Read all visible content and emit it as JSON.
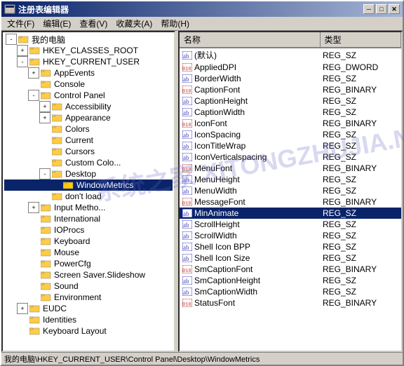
{
  "window": {
    "title": "注册表编辑器",
    "icon": "📋"
  },
  "titlebar_buttons": {
    "minimize": "─",
    "maximize": "□",
    "close": "✕"
  },
  "menu": {
    "items": [
      {
        "label": "文件(F)"
      },
      {
        "label": "编辑(E)"
      },
      {
        "label": "查看(V)"
      },
      {
        "label": "收藏夹(A)"
      },
      {
        "label": "帮助(H)"
      }
    ]
  },
  "tree": {
    "items": [
      {
        "id": "mypc",
        "label": "我的电脑",
        "level": 0,
        "expanded": true,
        "expander": "-",
        "has_expander": true
      },
      {
        "id": "hkcr",
        "label": "HKEY_CLASSES_ROOT",
        "level": 1,
        "expanded": false,
        "expander": "+",
        "has_expander": true
      },
      {
        "id": "hkcu",
        "label": "HKEY_CURRENT_USER",
        "level": 1,
        "expanded": true,
        "expander": "-",
        "has_expander": true
      },
      {
        "id": "appevents",
        "label": "AppEvents",
        "level": 2,
        "expanded": false,
        "expander": "+",
        "has_expander": true
      },
      {
        "id": "console",
        "label": "Console",
        "level": 2,
        "has_expander": false
      },
      {
        "id": "controlpanel",
        "label": "Control Panel",
        "level": 2,
        "expanded": true,
        "expander": "-",
        "has_expander": true
      },
      {
        "id": "accessibility",
        "label": "Accessibility",
        "level": 3,
        "expanded": false,
        "expander": "+",
        "has_expander": true
      },
      {
        "id": "appearance",
        "label": "Appearance",
        "level": 3,
        "expanded": false,
        "expander": "+",
        "has_expander": true
      },
      {
        "id": "colors",
        "label": "Colors",
        "level": 3,
        "has_expander": false
      },
      {
        "id": "current",
        "label": "Current",
        "level": 3,
        "has_expander": false
      },
      {
        "id": "cursors",
        "label": "Cursors",
        "level": 3,
        "has_expander": false
      },
      {
        "id": "customcolo",
        "label": "Custom Colo...",
        "level": 3,
        "has_expander": false
      },
      {
        "id": "desktop",
        "label": "Desktop",
        "level": 3,
        "expanded": true,
        "expander": "-",
        "has_expander": true
      },
      {
        "id": "windowmetrics",
        "label": "WindowMetrics",
        "level": 4,
        "has_expander": false,
        "selected": true
      },
      {
        "id": "dontload",
        "label": "don't load",
        "level": 3,
        "has_expander": false
      },
      {
        "id": "inputmetho",
        "label": "Input Metho...",
        "level": 2,
        "expanded": false,
        "expander": "+",
        "has_expander": true
      },
      {
        "id": "international",
        "label": "International",
        "level": 2,
        "has_expander": false
      },
      {
        "id": "ioprocs",
        "label": "IOProcs",
        "level": 2,
        "has_expander": false
      },
      {
        "id": "keyboard",
        "label": "Keyboard",
        "level": 2,
        "has_expander": false
      },
      {
        "id": "mouse",
        "label": "Mouse",
        "level": 2,
        "has_expander": false
      },
      {
        "id": "powercfg",
        "label": "PowerCfg",
        "level": 2,
        "has_expander": false
      },
      {
        "id": "screensaver",
        "label": "Screen Saver.Slideshow",
        "level": 2,
        "has_expander": false
      },
      {
        "id": "sound",
        "label": "Sound",
        "level": 2,
        "has_expander": false
      },
      {
        "id": "environment",
        "label": "Environment",
        "level": 2,
        "has_expander": false
      },
      {
        "id": "eudc",
        "label": "EUDC",
        "level": 1,
        "expanded": false,
        "expander": "+",
        "has_expander": true
      },
      {
        "id": "identities",
        "label": "Identities",
        "level": 1,
        "has_expander": false
      },
      {
        "id": "keyboardlayout",
        "label": "Keyboard Layout",
        "level": 1,
        "has_expander": false
      }
    ]
  },
  "table": {
    "columns": [
      {
        "label": "名称"
      },
      {
        "label": "类型"
      }
    ],
    "rows": [
      {
        "name": "(默认)",
        "type": "REG_SZ",
        "icon": "ab",
        "selected": false
      },
      {
        "name": "AppliedDPI",
        "type": "REG_DWORD",
        "icon": "bin",
        "selected": false
      },
      {
        "name": "BorderWidth",
        "type": "REG_SZ",
        "icon": "ab",
        "selected": false
      },
      {
        "name": "CaptionFont",
        "type": "REG_BINARY",
        "icon": "bin",
        "selected": false
      },
      {
        "name": "CaptionHeight",
        "type": "REG_SZ",
        "icon": "ab",
        "selected": false
      },
      {
        "name": "CaptionWidth",
        "type": "REG_SZ",
        "icon": "ab",
        "selected": false
      },
      {
        "name": "IconFont",
        "type": "REG_BINARY",
        "icon": "bin",
        "selected": false
      },
      {
        "name": "IconSpacing",
        "type": "REG_SZ",
        "icon": "ab",
        "selected": false
      },
      {
        "name": "IconTitleWrap",
        "type": "REG_SZ",
        "icon": "ab",
        "selected": false
      },
      {
        "name": "IconVerticalspacing",
        "type": "REG_SZ",
        "icon": "ab",
        "selected": false
      },
      {
        "name": "MenuFont",
        "type": "REG_BINARY",
        "icon": "bin",
        "selected": false
      },
      {
        "name": "MenuHeight",
        "type": "REG_SZ",
        "icon": "ab",
        "selected": false
      },
      {
        "name": "MenuWidth",
        "type": "REG_SZ",
        "icon": "ab",
        "selected": false
      },
      {
        "name": "MessageFont",
        "type": "REG_BINARY",
        "icon": "bin",
        "selected": false
      },
      {
        "name": "MinAnimate",
        "type": "REG_SZ",
        "icon": "ab",
        "selected": true
      },
      {
        "name": "ScrollHeight",
        "type": "REG_SZ",
        "icon": "ab",
        "selected": false
      },
      {
        "name": "ScrollWidth",
        "type": "REG_SZ",
        "icon": "ab",
        "selected": false
      },
      {
        "name": "Shell Icon BPP",
        "type": "REG_SZ",
        "icon": "ab",
        "selected": false
      },
      {
        "name": "Shell Icon Size",
        "type": "REG_SZ",
        "icon": "ab",
        "selected": false
      },
      {
        "name": "SmCaptionFont",
        "type": "REG_BINARY",
        "icon": "bin",
        "selected": false
      },
      {
        "name": "SmCaptionHeight",
        "type": "REG_SZ",
        "icon": "ab",
        "selected": false
      },
      {
        "name": "SmCaptionWidth",
        "type": "REG_SZ",
        "icon": "ab",
        "selected": false
      },
      {
        "name": "StatusFont",
        "type": "REG_BINARY",
        "icon": "bin",
        "selected": false
      }
    ]
  },
  "statusbar": {
    "text": "我的电脑\\HKEY_CURRENT_USER\\Control Panel\\Desktop\\WindowMetrics"
  },
  "overlay": {
    "text": "系统之家 XITONGZHUJIA.NET"
  }
}
